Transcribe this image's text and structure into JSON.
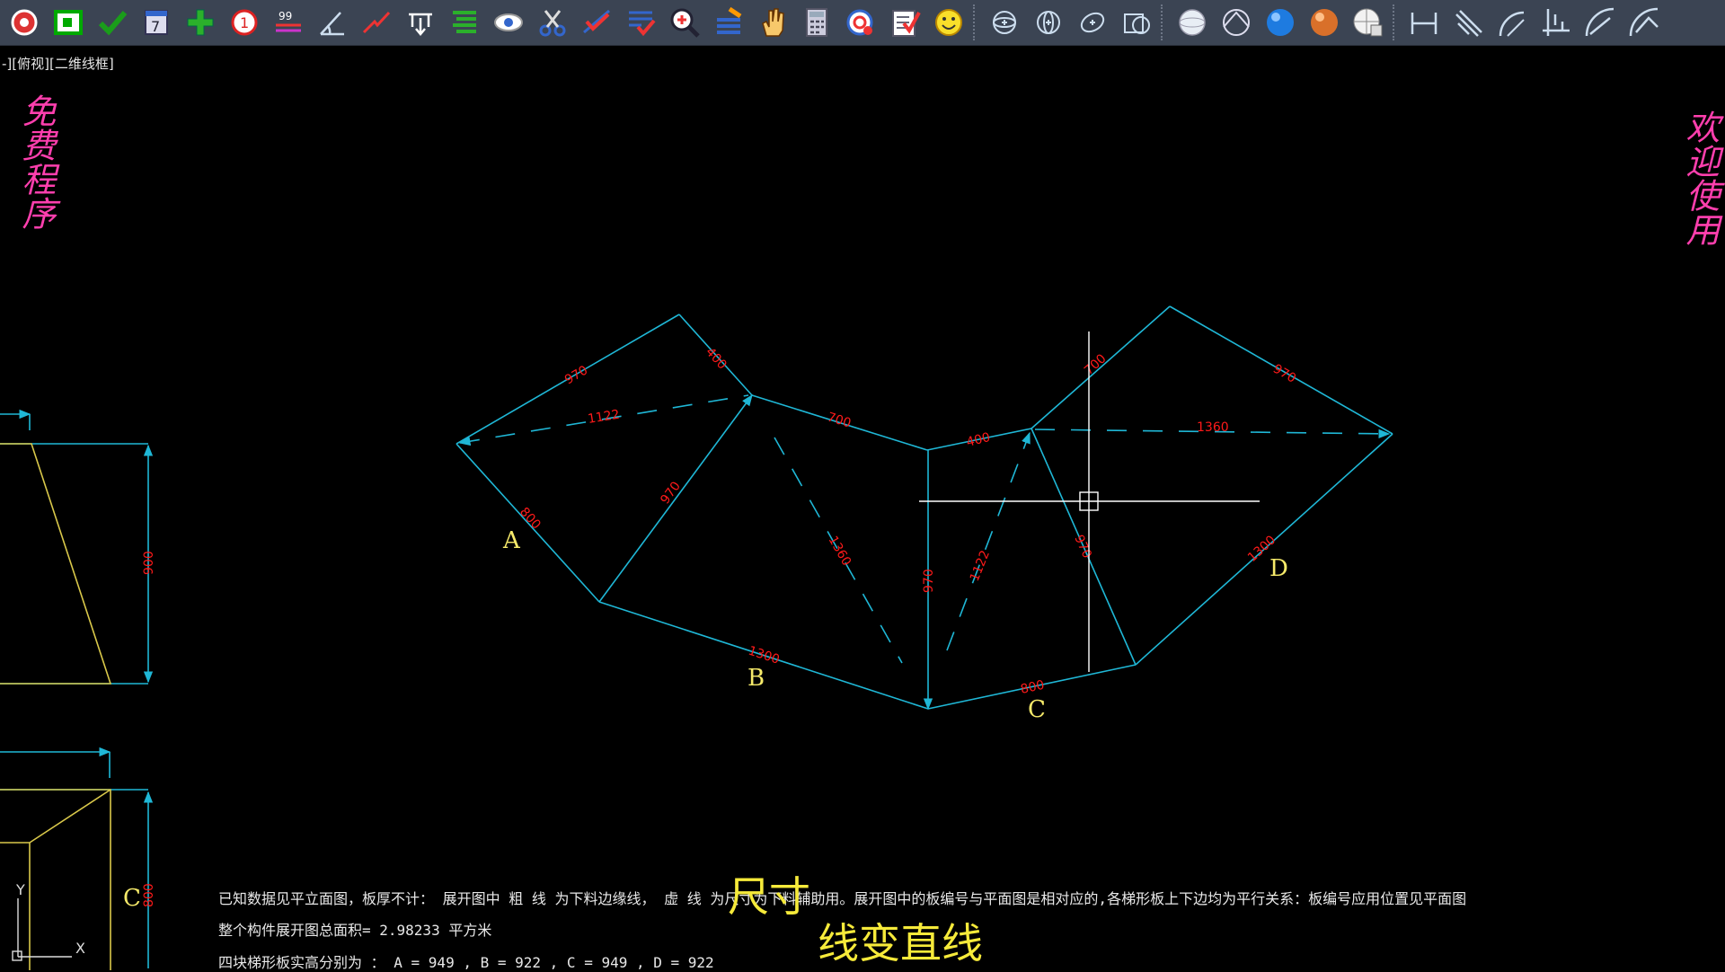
{
  "toolbar": {
    "buttons": [
      {
        "name": "settings-gear-icon",
        "group": 1
      },
      {
        "name": "frame-icon",
        "group": 1
      },
      {
        "name": "check-icon",
        "group": 1
      },
      {
        "name": "calendar-icon",
        "group": 1
      },
      {
        "name": "add-plus-icon",
        "group": 1
      },
      {
        "name": "number-circle-icon",
        "group": 1
      },
      {
        "name": "text-lines-icon",
        "group": 1
      },
      {
        "name": "angle-arc-icon",
        "group": 1
      },
      {
        "name": "break-line-icon",
        "group": 1
      },
      {
        "name": "dimension-icon",
        "group": 1
      },
      {
        "name": "align-lines-icon",
        "group": 1
      },
      {
        "name": "eye-icon",
        "group": 1
      },
      {
        "name": "scissors-icon",
        "group": 1
      },
      {
        "name": "extend-check-icon",
        "group": 1
      },
      {
        "name": "list-check-icon",
        "group": 1
      },
      {
        "name": "zoom-in-icon",
        "group": 1
      },
      {
        "name": "layer-edit-icon",
        "group": 1
      },
      {
        "name": "pan-hand-icon",
        "group": 1
      },
      {
        "name": "calculator-icon",
        "group": 1
      },
      {
        "name": "target-icon",
        "group": 1
      },
      {
        "name": "checklist-icon",
        "group": 1
      },
      {
        "name": "smiley-icon",
        "group": 1
      },
      {
        "name": "orbit-icon",
        "group": 2
      },
      {
        "name": "orbit-free-icon",
        "group": 2
      },
      {
        "name": "orbit-continuous-icon",
        "group": 2
      },
      {
        "name": "region-icon",
        "group": 2
      },
      {
        "name": "wire-sphere-icon",
        "group": 3
      },
      {
        "name": "hidden-sphere-icon",
        "group": 3
      },
      {
        "name": "blue-sphere-icon",
        "group": 3
      },
      {
        "name": "orange-sphere-icon",
        "group": 3
      },
      {
        "name": "grid-sphere-icon",
        "group": 3
      },
      {
        "name": "linear-dim-icon",
        "group": 4
      },
      {
        "name": "aligned-dim-icon",
        "group": 4
      },
      {
        "name": "arc-dim-icon",
        "group": 4
      },
      {
        "name": "ordinate-dim-icon",
        "group": 4
      },
      {
        "name": "radius-dim-icon",
        "group": 4
      },
      {
        "name": "diameter-dim-icon",
        "group": 4
      }
    ]
  },
  "viewport_label": "-][俯视][二维线框]",
  "left_vertical_text": "免费程序",
  "right_vertical_text": "欢迎使用",
  "colors": {
    "toolbar_bg": "#3b4453",
    "line": "#1fb7d6",
    "dim_text": "#ff1a1a",
    "label": "#f6ea6a",
    "outline_yellow": "#d9c84a",
    "vertical_text": "#ff3fae",
    "crosshair": "#ffffff"
  },
  "drawing": {
    "dims": {
      "d970a": "970",
      "d400a": "400",
      "d1122a": "1122",
      "d700a": "700",
      "d970b": "970",
      "d800a": "800",
      "d1360a": "1360",
      "d1300a": "1300",
      "d970c": "970",
      "d400b": "400",
      "d1122b": "1122",
      "d800b": "800",
      "d700b": "700",
      "d970d": "970",
      "d970e": "970",
      "d1360b": "1360",
      "d1300b": "1300",
      "d900": "900",
      "d800c": "800"
    },
    "labels": {
      "a": "A",
      "b": "B",
      "c": "C",
      "d": "D",
      "c2": "C"
    },
    "axis": {
      "y": "Y",
      "x": "X"
    }
  },
  "notes": {
    "line1": "已知数据见平立面图，板厚不计： 展开图中 粗 线 为下料边缘线， 虚 线 为尺寸为下料辅助用。展开图中的板编号与平面图是相对应的,各梯形板上下边均为平行关系：板编号应用位置见平面图",
    "line2": "整个构件展开图总面积= 2.98233 平方米",
    "line3": "四块梯形板实高分别为 ：  A = 949 ,  B = 922 , C = 949 , D = 922"
  },
  "captions": {
    "size": "尺寸",
    "straight": "线变直线"
  }
}
